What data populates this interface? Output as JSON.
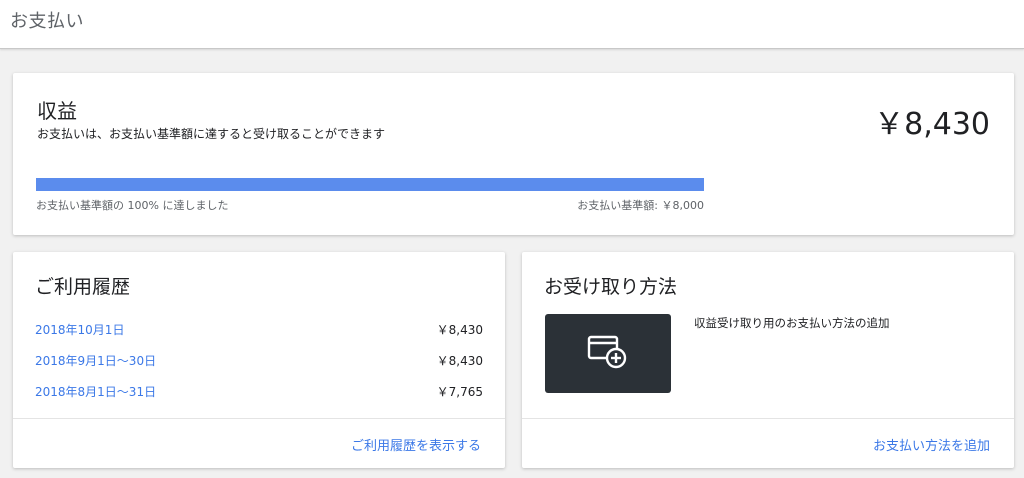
{
  "page": {
    "title": "お支払い"
  },
  "earnings": {
    "heading": "収益",
    "description": "お支払いは、お支払い基準額に達すると受け取ることができます",
    "amount": "￥8,430",
    "progress_fraction": 1.0,
    "progress_left_text": "お支払い基準額の 100% に達しました",
    "progress_right_text": "お支払い基準額: ￥8,000"
  },
  "history": {
    "heading": "ご利用履歴",
    "rows": [
      {
        "date": "2018年10月1日",
        "amount": "￥8,430"
      },
      {
        "date": "2018年9月1日～30日",
        "amount": "￥8,430"
      },
      {
        "date": "2018年8月1日～31日",
        "amount": "￥7,765"
      }
    ],
    "footer_link": "ご利用履歴を表示する"
  },
  "payment_method": {
    "heading": "お受け取り方法",
    "add_card_icon": "credit-card-add-icon",
    "add_text": "収益受け取り用のお支払い方法の追加",
    "footer_link": "お支払い方法を追加"
  },
  "colors": {
    "accent": "#3b78e7",
    "progress": "#5b8ced",
    "tile": "#2b3137"
  }
}
